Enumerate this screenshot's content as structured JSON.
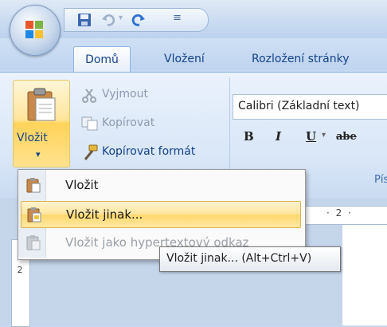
{
  "tabs": [
    {
      "label": "Domů"
    },
    {
      "label": "Vložení"
    },
    {
      "label": "Rozložení stránky"
    }
  ],
  "clipboard": {
    "paste_label": "Vložit",
    "cut_label": "Vyjmout",
    "copy_label": "Kopírovat",
    "format_painter_label": "Kopírovat formát"
  },
  "font": {
    "name_value": "Calibri (Základní text)",
    "bold": "B",
    "italic": "I",
    "underline": "U",
    "strike": "abe",
    "group_label": "Pís"
  },
  "ruler": {
    "marks": "· 2 ·",
    "vertical": "2"
  },
  "menu": {
    "items": [
      {
        "label": "Vložit"
      },
      {
        "label": "Vložit jinak..."
      },
      {
        "label": "Vložit jako hypertextový odkaz"
      }
    ]
  },
  "tooltip": {
    "text": "Vložit jinak... (Alt+Ctrl+V)"
  },
  "colors": {
    "accent": "#15428b",
    "highlight": "#ffe49a"
  },
  "icons": [
    "office-logo-icon",
    "save-icon",
    "undo-icon",
    "redo-icon",
    "qat-dropdown-icon",
    "paste-icon",
    "cut-icon",
    "copy-icon",
    "format-painter-icon"
  ]
}
